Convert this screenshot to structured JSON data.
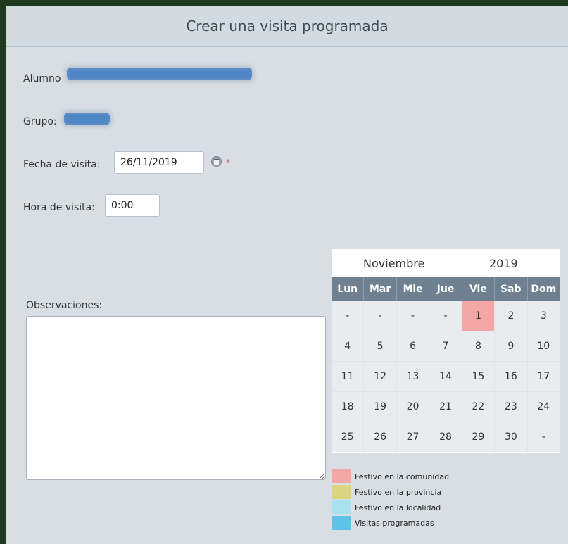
{
  "header": {
    "title": "Crear una visita programada"
  },
  "form": {
    "alumno_label": "Alumno",
    "grupo_label": "Grupo:",
    "fecha_label": "Fecha de visita:",
    "fecha_value": "26/11/2019",
    "required_mark": "*",
    "hora_label": "Hora de visita:",
    "hora_value": "0:00",
    "observaciones_label": "Observaciones:"
  },
  "calendar": {
    "month": "Noviembre",
    "year": "2019",
    "weekdays": [
      "Lun",
      "Mar",
      "Mie",
      "Jue",
      "Vie",
      "Sab",
      "Dom"
    ],
    "days": [
      "-",
      "-",
      "-",
      "-",
      "1",
      "2",
      "3",
      "4",
      "5",
      "6",
      "7",
      "8",
      "9",
      "10",
      "11",
      "12",
      "13",
      "14",
      "15",
      "16",
      "17",
      "18",
      "19",
      "20",
      "21",
      "22",
      "23",
      "24",
      "25",
      "26",
      "27",
      "28",
      "29",
      "30",
      "-"
    ],
    "holiday_days": [
      "1"
    ]
  },
  "legend": [
    {
      "label": "Festivo en la comunidad",
      "color": "#f5a6a6"
    },
    {
      "label": "Festivo en la provincia",
      "color": "#d9d67f"
    },
    {
      "label": "Festivo en la localidad",
      "color": "#a8e2ef"
    },
    {
      "label": "Visitas programadas",
      "color": "#5ec3e6"
    }
  ]
}
